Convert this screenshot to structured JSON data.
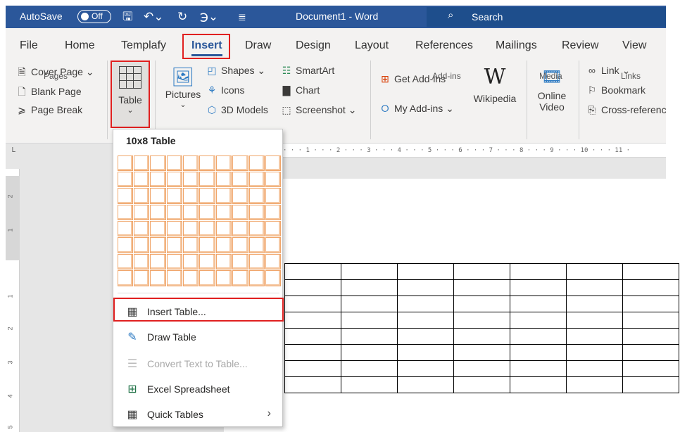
{
  "title_bar": {
    "autosave_label": "AutoSave",
    "autosave_state": "Off",
    "save_icon": "save-icon",
    "undo_icon": "undo-icon",
    "redo_icon": "redo-icon",
    "document_title": "Document1  -  Word",
    "search_placeholder": "Search"
  },
  "tabs": [
    "File",
    "Home",
    "Templafy",
    "Insert",
    "Draw",
    "Design",
    "Layout",
    "References",
    "Mailings",
    "Review",
    "View"
  ],
  "active_tab": "Insert",
  "ribbon": {
    "pages": {
      "cover_page": "Cover Page",
      "blank_page": "Blank Page",
      "page_break": "Page Break",
      "group": "Pages"
    },
    "table": {
      "label": "Table"
    },
    "illustrations": {
      "pictures": "Pictures",
      "shapes": "Shapes",
      "icons": "Icons",
      "models": "3D Models",
      "smartart": "SmartArt",
      "chart": "Chart",
      "screenshot": "Screenshot"
    },
    "addins": {
      "get": "Get Add-ins",
      "my": "My Add-ins",
      "wikipedia": "Wikipedia",
      "group": "Add-ins"
    },
    "media": {
      "online": "Online",
      "video": "Video",
      "group": "Media"
    },
    "links": {
      "link": "Link",
      "bookmark": "Bookmark",
      "cross_reference": "Cross-referenc",
      "group": "Links"
    }
  },
  "ruler": {
    "marks": "· · · 1 · · · 2 · · · 3 · · · 4 · · · 5 · · · 6 · · · 7 · · · 8 · · · 9 · · · 10 · · · 11 ·"
  },
  "vruler_nums": [
    "2",
    "1",
    "1",
    "2",
    "3",
    "4",
    "5"
  ],
  "dropdown": {
    "grid_label": "10x8 Table",
    "grid_cols": 10,
    "grid_rows": 8,
    "items": [
      {
        "label": "Insert Table...",
        "icon": "table-grid-icon",
        "enabled": true
      },
      {
        "label": "Draw Table",
        "icon": "draw-table-icon",
        "enabled": true
      },
      {
        "label": "Convert Text to Table...",
        "icon": "convert-text-icon",
        "enabled": false
      },
      {
        "label": "Excel Spreadsheet",
        "icon": "excel-icon",
        "enabled": true
      },
      {
        "label": "Quick Tables",
        "icon": "quick-tables-icon",
        "enabled": true
      }
    ]
  },
  "colors": {
    "word_blue": "#2b579a",
    "highlight_red": "#e02020",
    "grid_orange": "#f0a66b"
  }
}
